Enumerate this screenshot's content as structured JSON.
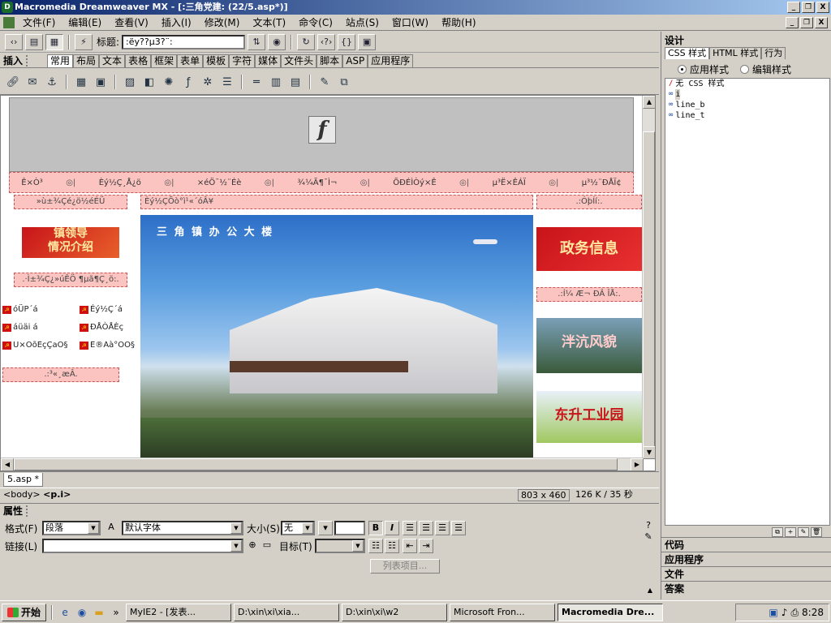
{
  "window": {
    "title": "Macromedia Dreamweaver MX - [:三角党建: (22/5.asp*)]",
    "controls": [
      "_",
      "❐",
      "X"
    ]
  },
  "menu": {
    "items": [
      "文件(F)",
      "编辑(E)",
      "查看(V)",
      "插入(I)",
      "修改(M)",
      "文本(T)",
      "命令(C)",
      "站点(S)",
      "窗口(W)",
      "帮助(H)"
    ],
    "doc_controls": [
      "_",
      "❐",
      "X"
    ]
  },
  "doc_toolbar": {
    "title_label": "标题:",
    "title_value": ":ëy??μ3?¨:"
  },
  "insert_bar": {
    "label": "插入",
    "tabs": [
      "常用",
      "布局",
      "文本",
      "表格",
      "框架",
      "表单",
      "模板",
      "字符",
      "媒体",
      "文件头",
      "脚本",
      "ASP",
      "应用程序"
    ],
    "selected_tab": 0
  },
  "page": {
    "nav_items": [
      "Ê×Ò³",
      "Èý½Ç¸Å¿ö",
      "×éÖ¯½¨Éè",
      "¾­¼Ã¶¯Ì¬",
      "ÕÐÉÌÒý×Ê",
      "µ³Ë×ÊÁÏ",
      "µ³½¨ÐÅÏ¢"
    ],
    "nav_sep": "◎|",
    "left_header": "»ù±¾Çé¿ö½éÉÜ",
    "left_banner": "镇领导\n情况介绍",
    "left_sub": ".·Ì±¾Ç¿»úÊÖ ¶µã¶Ç¸ö:.",
    "left_links": [
      [
        "óÜP´á",
        "Éý½Ç´á"
      ],
      [
        "áüäi á",
        "ÐÅÒÅÈç"
      ],
      [
        "Ü×ÖõÈçÇaÖ§",
        "Ê®Áà°ÓÖ§"
      ]
    ],
    "left_footer": ".:³«¸æÂ.",
    "center_header": "Èý½ÇÕò°ì¹«´óÂ¥",
    "photo_caption": "三 角 镇 办 公 大 楼",
    "right_header": ".:ÓþÍí:.",
    "right_banner1": "政务信息",
    "right_sub": ".:Í¼ Æ¬ ÐÂ ÎÅ:.",
    "right_banner2": "泮沆风貌",
    "right_banner3": "东升工业园"
  },
  "doc_tab": "5.asp *",
  "status": {
    "tag_body": "<body>",
    "tag_p": "<p.i>",
    "window_size": "803 x 460",
    "download": "126 K / 35 秒"
  },
  "properties": {
    "label": "属性",
    "format_label": "格式(F)",
    "format_value": "段落",
    "font_value": "默认字体",
    "size_label": "大小(S)",
    "size_value": "无",
    "link_label": "链接(L)",
    "link_value": "",
    "target_label": "目标(T)",
    "list_button": "列表项目..."
  },
  "right_panel": {
    "design_label": "设计",
    "tabs": [
      "CSS 样式",
      "HTML 样式",
      "行为"
    ],
    "radio_apply": "应用样式",
    "radio_edit": "编辑样式",
    "styles": [
      "无 CSS 样式",
      "i",
      "line_b",
      "line_t"
    ],
    "selected_style": 1,
    "collapsed_panels": [
      "代码",
      "应用程序",
      "文件",
      "答案"
    ]
  },
  "taskbar": {
    "start": "开始",
    "tasks": [
      "MyIE2 - [发表...",
      "D:\\xin\\xi\\xia...",
      "D:\\xin\\xi\\w2",
      "Microsoft Fron...",
      "Macromedia Dre..."
    ],
    "active_task": 4,
    "clock": "8:28"
  }
}
